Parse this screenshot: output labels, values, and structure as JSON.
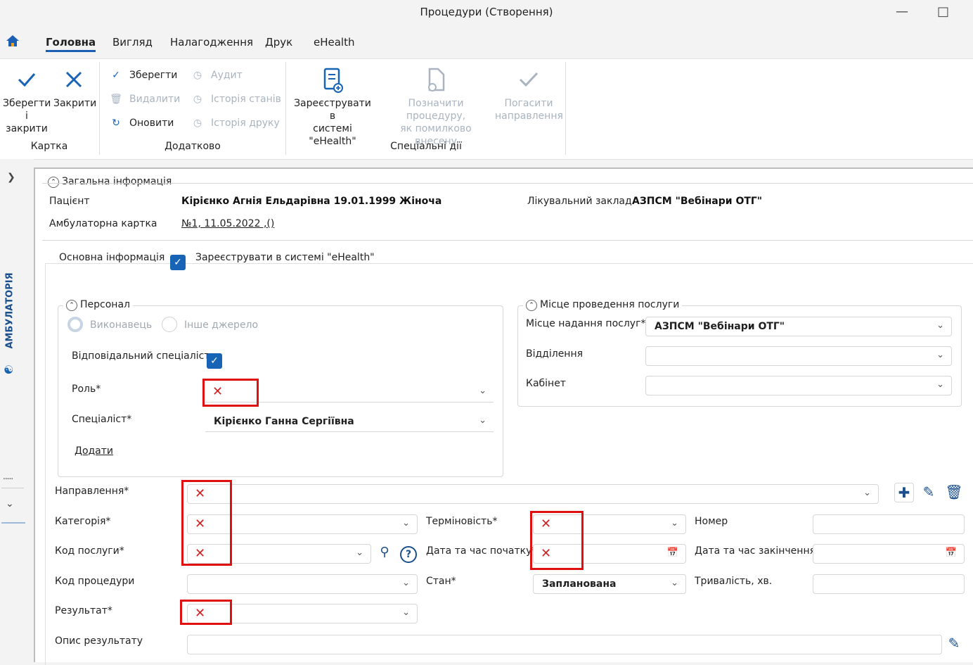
{
  "window": {
    "title": "Процедури (Створення)"
  },
  "menu": {
    "items": [
      "Головна",
      "Вигляд",
      "Налагодження",
      "Друк",
      "eHealth"
    ]
  },
  "ribbon": {
    "card": {
      "save_close": [
        "Зберегти",
        "і закрити"
      ],
      "close": "Закрити",
      "group": "Картка"
    },
    "extra": {
      "save": "Зберегти",
      "delete": "Видалити",
      "refresh": "Оновити",
      "audit": "Аудит",
      "state_history": "Історія станів",
      "print_history": "Історія друку",
      "group": "Додатково"
    },
    "special": {
      "register": [
        "Зареєструвати в",
        "системі \"eHealth\""
      ],
      "mark_error": [
        "Позначити процедуру,",
        "як помилково внесену"
      ],
      "close_referral": [
        "Погасити",
        "направлення"
      ],
      "group": "Спеціальні дії"
    }
  },
  "sidebar": {
    "label": "АМБУЛАТОРІЯ"
  },
  "general": {
    "title": "Загальна інформація",
    "patient_label": "Пацієнт",
    "patient_value": "Кірієнко Агнія Ельдарівна 19.01.1999 Жіноча",
    "facility_label": "Лікувальний заклад",
    "facility_value": "АЗПСМ \"Вебінари ОТГ\"",
    "card_label": "Амбулаторна картка",
    "card_value": "№1, 11.05.2022 ,()"
  },
  "main_info": {
    "tab": "Основна інформація",
    "register_label": "Зареєструвати в системі \"eHealth\""
  },
  "personnel": {
    "title": "Персонал",
    "radio_performer": "Виконавець",
    "radio_other": "Інше джерело",
    "responsible_label": "Відповідальний спеціаліст",
    "role_label": "Роль*",
    "specialist_label": "Спеціаліст*",
    "specialist_value": "Кірієнко Ганна Сергіївна",
    "add_link": "Додати"
  },
  "place": {
    "title": "Місце проведення послуги",
    "location_label": "Місце надання послуг*",
    "location_value": "АЗПСМ \"Вебінари ОТГ\"",
    "department_label": "Відділення",
    "room_label": "Кабінет"
  },
  "form": {
    "referral_label": "Направлення*",
    "category_label": "Категорія*",
    "urgency_label": "Терміновість*",
    "number_label": "Номер",
    "service_code_label": "Код послуги*",
    "start_label": "Дата та час початку*",
    "end_label": "Дата та час закінчення",
    "procedure_code_label": "Код процедури",
    "state_label": "Стан*",
    "state_value": "Запланована",
    "duration_label": "Тривалість, хв.",
    "result_label": "Результат*",
    "result_desc_label": "Опис результату"
  }
}
